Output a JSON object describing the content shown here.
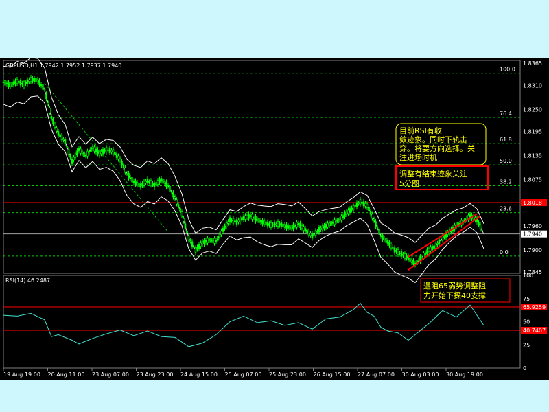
{
  "chart_data": [
    {
      "type": "candlestick",
      "title": "GBPUSD,H1",
      "ohlc": "1.7942 1.7952 1.7937 1.7940",
      "ylim": [
        1.7842,
        1.8372
      ],
      "yticks": [
        "1.8365",
        "1.8310",
        "1.8250",
        "1.8195",
        "1.8135",
        "1.8075",
        "1.8018",
        "1.7960",
        "1.7940",
        "1.7900",
        "1.7845"
      ],
      "xticks": [
        "19 Aug 19:00",
        "20 Aug 11:00",
        "23 Aug 07:00",
        "23 Aug 23:00",
        "24 Aug 15:00",
        "25 Aug 07:00",
        "25 Aug 23:00",
        "26 Aug 15:00",
        "27 Aug 07:00",
        "30 Aug 03:00",
        "30 Aug 19:00"
      ],
      "current_price": 1.794,
      "resistance": 1.8018,
      "fibonacci": [
        {
          "label": "100.0",
          "value": 1.834
        },
        {
          "label": "76.4",
          "value": 1.823
        },
        {
          "label": "61.8",
          "value": 1.8165
        },
        {
          "label": "50.0",
          "value": 1.8112
        },
        {
          "label": "38.2",
          "value": 1.806
        },
        {
          "label": "23.6",
          "value": 1.7993
        },
        {
          "label": "0.0",
          "value": 1.7885
        }
      ],
      "series": [
        {
          "x": 0,
          "y": 1.8318
        },
        {
          "x": 10,
          "y": 1.831
        },
        {
          "x": 20,
          "y": 1.832
        },
        {
          "x": 30,
          "y": 1.8312
        },
        {
          "x": 40,
          "y": 1.8325
        },
        {
          "x": 50,
          "y": 1.8322
        },
        {
          "x": 60,
          "y": 1.83
        },
        {
          "x": 70,
          "y": 1.823
        },
        {
          "x": 80,
          "y": 1.819
        },
        {
          "x": 90,
          "y": 1.817
        },
        {
          "x": 100,
          "y": 1.812
        },
        {
          "x": 110,
          "y": 1.815
        },
        {
          "x": 120,
          "y": 1.8135
        },
        {
          "x": 130,
          "y": 1.8155
        },
        {
          "x": 140,
          "y": 1.814
        },
        {
          "x": 150,
          "y": 1.815
        },
        {
          "x": 160,
          "y": 1.8145
        },
        {
          "x": 170,
          "y": 1.8125
        },
        {
          "x": 180,
          "y": 1.809
        },
        {
          "x": 190,
          "y": 1.807
        },
        {
          "x": 200,
          "y": 1.806
        },
        {
          "x": 210,
          "y": 1.8072
        },
        {
          "x": 220,
          "y": 1.8062
        },
        {
          "x": 230,
          "y": 1.8075
        },
        {
          "x": 240,
          "y": 1.806
        },
        {
          "x": 250,
          "y": 1.803
        },
        {
          "x": 260,
          "y": 1.799
        },
        {
          "x": 270,
          "y": 1.793
        },
        {
          "x": 280,
          "y": 1.79
        },
        {
          "x": 290,
          "y": 1.7918
        },
        {
          "x": 300,
          "y": 1.7925
        },
        {
          "x": 310,
          "y": 1.7922
        },
        {
          "x": 320,
          "y": 1.795
        },
        {
          "x": 330,
          "y": 1.7975
        },
        {
          "x": 340,
          "y": 1.797
        },
        {
          "x": 350,
          "y": 1.798
        },
        {
          "x": 360,
          "y": 1.7985
        },
        {
          "x": 370,
          "y": 1.7975
        },
        {
          "x": 380,
          "y": 1.7968
        },
        {
          "x": 390,
          "y": 1.7962
        },
        {
          "x": 400,
          "y": 1.7965
        },
        {
          "x": 410,
          "y": 1.796
        },
        {
          "x": 420,
          "y": 1.7955
        },
        {
          "x": 430,
          "y": 1.7965
        },
        {
          "x": 440,
          "y": 1.795
        },
        {
          "x": 450,
          "y": 1.7935
        },
        {
          "x": 460,
          "y": 1.795
        },
        {
          "x": 470,
          "y": 1.796
        },
        {
          "x": 480,
          "y": 1.7968
        },
        {
          "x": 490,
          "y": 1.7975
        },
        {
          "x": 500,
          "y": 1.7992
        },
        {
          "x": 510,
          "y": 1.8005
        },
        {
          "x": 520,
          "y": 1.802
        },
        {
          "x": 530,
          "y": 1.801
        },
        {
          "x": 540,
          "y": 1.7975
        },
        {
          "x": 550,
          "y": 1.7935
        },
        {
          "x": 560,
          "y": 1.792
        },
        {
          "x": 570,
          "y": 1.79
        },
        {
          "x": 580,
          "y": 1.789
        },
        {
          "x": 590,
          "y": 1.788
        },
        {
          "x": 600,
          "y": 1.7865
        },
        {
          "x": 610,
          "y": 1.7882
        },
        {
          "x": 620,
          "y": 1.79
        },
        {
          "x": 630,
          "y": 1.791
        },
        {
          "x": 640,
          "y": 1.793
        },
        {
          "x": 650,
          "y": 1.7945
        },
        {
          "x": 660,
          "y": 1.796
        },
        {
          "x": 670,
          "y": 1.797
        },
        {
          "x": 680,
          "y": 1.7985
        },
        {
          "x": 690,
          "y": 1.7975
        },
        {
          "x": 700,
          "y": 1.794
        }
      ],
      "annotations": [
        "目前RSI有收敛迹象。同时下轨击穿。将要方向选择。关注进场时机",
        "调整有结束迹象关注5分图"
      ]
    },
    {
      "type": "line",
      "title": "RSI(14) 46.2487",
      "ylim": [
        0,
        100
      ],
      "yticks": [
        "100",
        "75",
        "65.9259",
        "50",
        "40.7407",
        "25",
        "0"
      ],
      "levels": [
        65.9259,
        40.7407
      ],
      "series": [
        {
          "x": 0,
          "y": 57
        },
        {
          "x": 20,
          "y": 56
        },
        {
          "x": 40,
          "y": 59
        },
        {
          "x": 60,
          "y": 52
        },
        {
          "x": 70,
          "y": 34
        },
        {
          "x": 80,
          "y": 36
        },
        {
          "x": 100,
          "y": 30
        },
        {
          "x": 110,
          "y": 26
        },
        {
          "x": 130,
          "y": 32
        },
        {
          "x": 150,
          "y": 37
        },
        {
          "x": 170,
          "y": 41
        },
        {
          "x": 190,
          "y": 35
        },
        {
          "x": 210,
          "y": 40
        },
        {
          "x": 230,
          "y": 34
        },
        {
          "x": 250,
          "y": 33
        },
        {
          "x": 270,
          "y": 23
        },
        {
          "x": 290,
          "y": 27
        },
        {
          "x": 310,
          "y": 36
        },
        {
          "x": 330,
          "y": 50
        },
        {
          "x": 350,
          "y": 56
        },
        {
          "x": 370,
          "y": 49
        },
        {
          "x": 390,
          "y": 51
        },
        {
          "x": 410,
          "y": 46
        },
        {
          "x": 430,
          "y": 49
        },
        {
          "x": 450,
          "y": 42
        },
        {
          "x": 470,
          "y": 53
        },
        {
          "x": 490,
          "y": 55
        },
        {
          "x": 510,
          "y": 63
        },
        {
          "x": 520,
          "y": 70
        },
        {
          "x": 530,
          "y": 60
        },
        {
          "x": 540,
          "y": 56
        },
        {
          "x": 550,
          "y": 44
        },
        {
          "x": 560,
          "y": 40
        },
        {
          "x": 575,
          "y": 38
        },
        {
          "x": 590,
          "y": 30
        },
        {
          "x": 600,
          "y": 36
        },
        {
          "x": 620,
          "y": 48
        },
        {
          "x": 640,
          "y": 62
        },
        {
          "x": 660,
          "y": 55
        },
        {
          "x": 680,
          "y": 68
        },
        {
          "x": 700,
          "y": 46
        }
      ],
      "annotation": "遇阻65弱势调整阻力开始下探40支撑"
    }
  ]
}
